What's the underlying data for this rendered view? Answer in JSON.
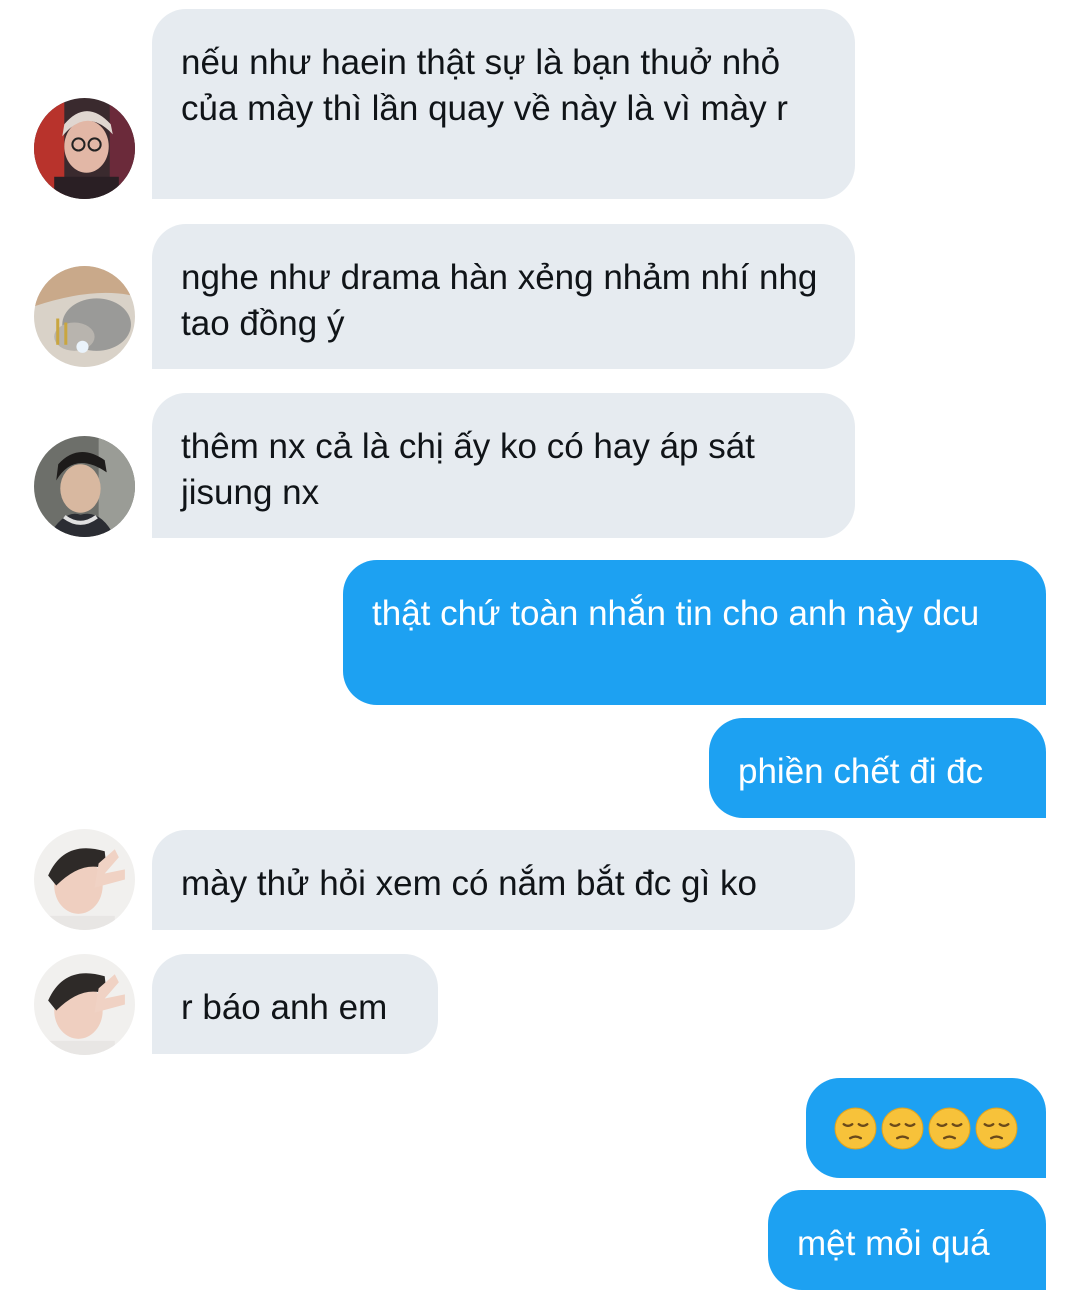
{
  "colors": {
    "incoming_bubble": "#e6ebf0",
    "outgoing_bubble": "#1da1f2",
    "incoming_text": "#101418",
    "outgoing_text": "#ffffff"
  },
  "messages": [
    {
      "direction": "incoming",
      "avatar": "avatar-1",
      "text": "nếu như haein thật sự là bạn thuở nhỏ của mày thì lần quay về này là vì mày r"
    },
    {
      "direction": "incoming",
      "avatar": "avatar-2",
      "text": "nghe như drama hàn xẻng nhảm nhí nhg tao đồng ý"
    },
    {
      "direction": "incoming",
      "avatar": "avatar-3",
      "text": "thêm nx cả là chị ấy ko có hay áp sát jisung nx"
    },
    {
      "direction": "outgoing",
      "text": "thật chứ toàn nhắn tin cho anh này dcu"
    },
    {
      "direction": "outgoing",
      "text": "phiền chết đi đc"
    },
    {
      "direction": "incoming",
      "avatar": "avatar-4",
      "text": "mày thử hỏi xem có nắm bắt đc gì ko"
    },
    {
      "direction": "incoming",
      "avatar": "avatar-4",
      "text": "r báo anh em"
    },
    {
      "direction": "outgoing",
      "emojis": [
        "pensive-face-emoji",
        "pensive-face-emoji",
        "pensive-face-emoji",
        "pensive-face-emoji"
      ]
    },
    {
      "direction": "outgoing",
      "text": "mệt mỏi quá"
    }
  ]
}
